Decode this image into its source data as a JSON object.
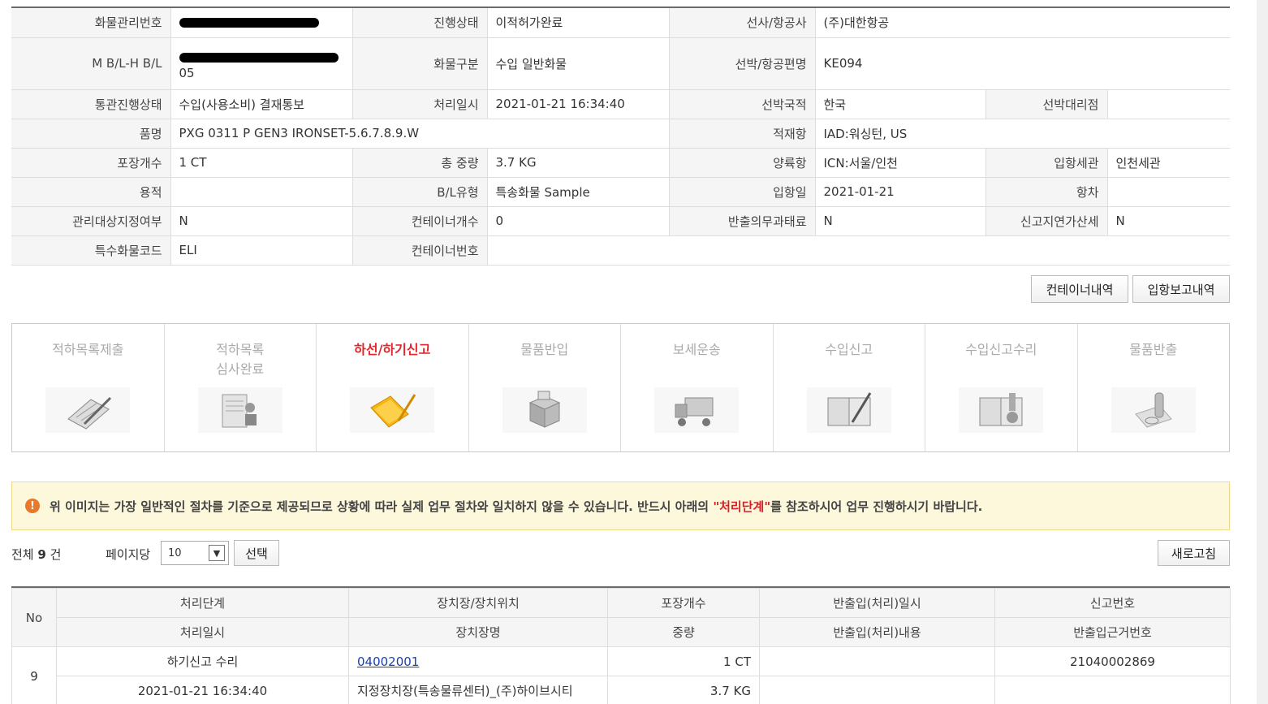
{
  "cargo_info": {
    "cargo_no_label": "화물관리번호",
    "progress_label": "진행상태",
    "progress_value": "이적허가완료",
    "carrier_label": "선사/항공사",
    "carrier_value": "(주)대한항공",
    "mbl_label": "M B/L-H B/L",
    "mbl_value_tail": "05",
    "cargo_type_label": "화물구분",
    "cargo_type_value": "수입 일반화물",
    "vessel_label": "선박/항공편명",
    "vessel_value": "KE094",
    "clearance_label": "통관진행상태",
    "clearance_value": "수입(사용소비) 결재통보",
    "proc_time_label": "처리일시",
    "proc_time_value": "2021-01-21 16:34:40",
    "nationality_label": "선박국적",
    "nationality_value": "한국",
    "agent_label": "선박대리점",
    "agent_value": "",
    "item_label": "품명",
    "item_value": "PXG 0311 P GEN3 IRONSET-5.6.7.8.9.W",
    "loading_port_label": "적재항",
    "loading_port_value": "IAD:워싱턴, US",
    "pkg_label": "포장개수",
    "pkg_value": "1 CT",
    "weight_label": "총 중량",
    "weight_value": "3.7 KG",
    "unloading_port_label": "양륙항",
    "unloading_port_value": "ICN:서울/인천",
    "customs_label": "입항세관",
    "customs_value": "인천세관",
    "volume_label": "용적",
    "volume_value": "",
    "bl_type_label": "B/L유형",
    "bl_type_value": "특송화물 Sample",
    "arrival_label": "입항일",
    "arrival_value": "2021-01-21",
    "voyage_label": "항차",
    "voyage_value": "",
    "managed_label": "관리대상지정여부",
    "managed_value": "N",
    "container_count_label": "컨테이너개수",
    "container_count_value": "0",
    "release_fine_label": "반출의무과태료",
    "release_fine_value": "N",
    "delay_tax_label": "신고지연가산세",
    "delay_tax_value": "N",
    "special_code_label": "특수화물코드",
    "special_code_value": "ELI",
    "container_no_label": "컨테이너번호",
    "container_no_value": ""
  },
  "buttons": {
    "container_history": "컨테이너내역",
    "arrival_report": "입항보고내역",
    "select": "선택",
    "refresh": "새로고침"
  },
  "steps": [
    {
      "label": "적하목록제출",
      "icon": "clipboard-pen-icon"
    },
    {
      "label": "적하목록\n심사완료",
      "icon": "document-stamp-icon"
    },
    {
      "label": "하선/하기신고",
      "icon": "folder-pen-icon"
    },
    {
      "label": "물품반입",
      "icon": "boxes-icon"
    },
    {
      "label": "보세운송",
      "icon": "truck-icon"
    },
    {
      "label": "수입신고",
      "icon": "book-pen-icon"
    },
    {
      "label": "수입신고수리",
      "icon": "book-stamp-icon"
    },
    {
      "label": "물품반출",
      "icon": "stamp-icon"
    }
  ],
  "active_step": 2,
  "notice": {
    "before": "위 이미지는 가장 일반적인 절차를 기준으로 제공되므로 상황에 따라 실제 업무 절차와 일치하지 않을 수 있습니다. 반드시 아래의 ",
    "highlight": "\"처리단계\"",
    "after": "를 참조하시어 업무 진행하시기 바랍니다."
  },
  "list_controls": {
    "total_prefix": "전체",
    "total_count": "9",
    "total_suffix": "건",
    "per_page_label": "페이지당",
    "per_page_value": "10"
  },
  "result_table": {
    "headers_row1": [
      "No",
      "처리단계",
      "장치장/장치위치",
      "포장개수",
      "반출입(처리)일시",
      "신고번호"
    ],
    "headers_row2": [
      "처리일시",
      "장치장명",
      "중량",
      "반출입(처리)내용",
      "반출입근거번호"
    ],
    "rows": [
      {
        "no": "9",
        "step": "하기신고 수리",
        "location_code": "04002001",
        "pkg": "1 CT",
        "inout_time": "",
        "report_no": "21040002869",
        "proc_time": "2021-01-21 16:34:40",
        "location_name": "지정장치장(특송물류센터)_(주)하이브시티",
        "weight": "3.7 KG",
        "inout_content": "",
        "basis_no": ""
      }
    ]
  }
}
